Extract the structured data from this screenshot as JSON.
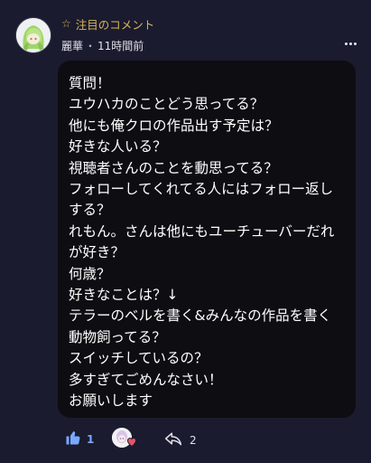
{
  "comment": {
    "pinned_label": "注目のコメント",
    "author": "麗華",
    "separator": "・",
    "time": "11時間前",
    "lines": [
      "質問！",
      "ユウハカのことどう思ってる？",
      "他にも俺クロの作品出す予定は？",
      "好きな人いる？",
      "視聴者さんのことを動思ってる？",
      "フォローしてくれてる人にはフォロー返し",
      "する？",
      "れもん。さんは他にもユーチューバーだれ",
      "が好き？",
      "何歳？",
      "好きなことは？↓",
      "テラーのベルを書く&みんなの作品を書く",
      "動物飼ってる？",
      "スイッチしているの？",
      "多すぎてごめんなさい！",
      "お願いします"
    ]
  },
  "actions": {
    "like_count": "1",
    "reply_count": "2"
  },
  "colors": {
    "background": "#1a1b2e",
    "bubble": "#0d0d12",
    "pinned": "#d9b45a",
    "like": "#7aa8ff",
    "heart": "#e0566a"
  }
}
